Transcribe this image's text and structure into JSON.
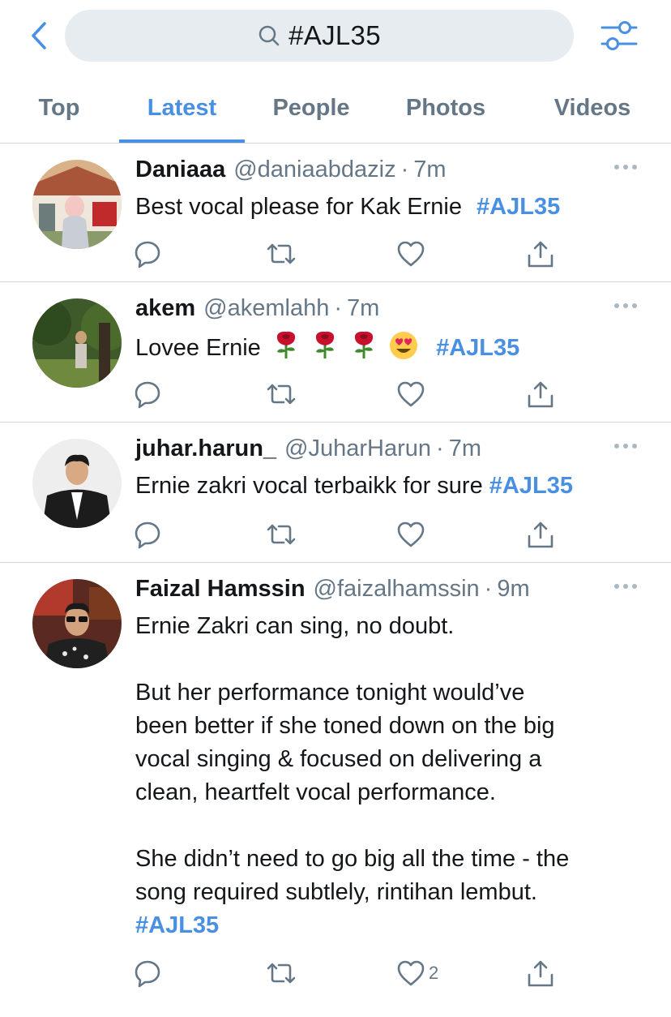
{
  "search": {
    "query": "#AJL35"
  },
  "tabs": [
    {
      "label": "Top"
    },
    {
      "label": "Latest"
    },
    {
      "label": "People"
    },
    {
      "label": "Photos"
    },
    {
      "label": "Videos"
    }
  ],
  "active_tab": "Latest",
  "colors": {
    "accent": "#4a90e2",
    "muted": "#657786",
    "divider": "#ccd6dd",
    "search_bg": "#e6ecf0"
  },
  "tweets": [
    {
      "name": "Daniaaa",
      "handle": "@daniaabdaziz",
      "time": "7m",
      "text": "Best vocal please for Kak Ernie ",
      "hashtag": "#AJL35",
      "like_count": ""
    },
    {
      "name": "akem",
      "handle": "@akemlahh",
      "time": "7m",
      "text": "Lovee Ernie",
      "hashtag": "#AJL35",
      "emojis": [
        "rose-emoji",
        "rose-emoji",
        "rose-emoji",
        "heart-eyes-emoji"
      ],
      "like_count": ""
    },
    {
      "name": "juhar.harun_",
      "handle": "@JuharHarun",
      "time": "7m",
      "text": "Ernie zakri vocal terbaikk for sure ",
      "hashtag": "#AJL35",
      "like_count": ""
    },
    {
      "name": "Faizal Hamssin",
      "handle": "@faizalhamssin",
      "time": "9m",
      "lines": [
        "Ernie Zakri can sing, no doubt.",
        "",
        "But her performance tonight would’ve",
        "been better if she toned down on the big",
        "vocal singing & focused on delivering a",
        "clean, heartfelt vocal performance.",
        "",
        "She didn’t need to go big all the time - the",
        "song required subtlely, rintihan lembut."
      ],
      "hashtag": "#AJL35",
      "like_count": "2"
    }
  ],
  "separator": "·",
  "icons": {
    "back": "chevron-left-icon",
    "search": "search-icon",
    "filter": "filter-sliders-icon",
    "reply": "reply-icon",
    "retweet": "retweet-icon",
    "like": "heart-icon",
    "share": "share-icon",
    "more": "more-icon"
  }
}
